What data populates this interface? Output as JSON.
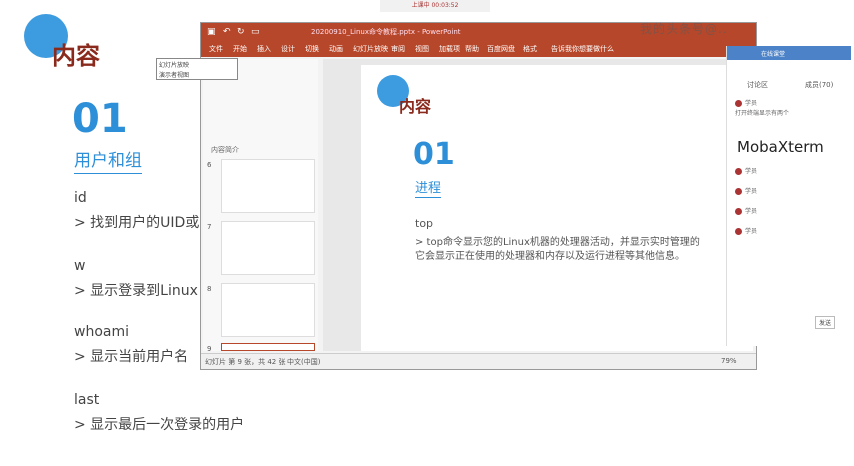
{
  "background_slide": {
    "title": "内容",
    "number": "01",
    "subtitle": "用户和组",
    "items": [
      {
        "cmd": "id",
        "desc": "> 找到用户的UID或"
      },
      {
        "cmd": "w",
        "desc": "> 显示登录到Linux"
      },
      {
        "cmd": "whoami",
        "desc": "> 显示当前用户名"
      },
      {
        "cmd": "last",
        "desc": "> 显示最后一次登录的用户"
      }
    ]
  },
  "top_recording_bar": {
    "label": "上课中 00:03:52"
  },
  "watermark": "我的头条号@..",
  "ppt": {
    "doc_title": "20200910_Linux命令教程.pptx - PowerPoint",
    "ribbon_tabs": [
      "文件",
      "开始",
      "插入",
      "设计",
      "切换",
      "动画",
      "幻灯片放映",
      "审阅",
      "视图",
      "加载项",
      "帮助",
      "百度网盘",
      "格式",
      "告诉我你想要做什么"
    ],
    "thumb_section_label": "内容简介",
    "thumb_numbers": [
      "6",
      "7",
      "8",
      "9"
    ],
    "status": {
      "slide_info": "幻灯片 第 9 张，共 42 张",
      "language": "中文(中国)",
      "zoom": "79%"
    },
    "slide": {
      "title": "内容",
      "number": "01",
      "subtitle": "进程",
      "cmd": "top",
      "desc_line1": "> top命令显示您的Linux机器的处理器活动，并显示实时管理的",
      "desc_line2": "它会显示正在使用的处理器和内存以及运行进程等其他信息。"
    }
  },
  "popup": {
    "line1": "幻灯片放映",
    "line2": "演示者视图"
  },
  "panel": {
    "header": "在线课堂",
    "tabs": [
      "讨论区",
      "成员(70)"
    ],
    "rows": [
      "学员",
      "打开终端显示有两个",
      "MobaXterm",
      "学员",
      "学员",
      "学员",
      "学员"
    ],
    "moba_label": "MobaXterm",
    "send_button": "发送"
  },
  "colors": {
    "ppt_red": "#b7472a",
    "accent_blue": "#2d8fd8",
    "title_brown": "#8a2a1c"
  }
}
